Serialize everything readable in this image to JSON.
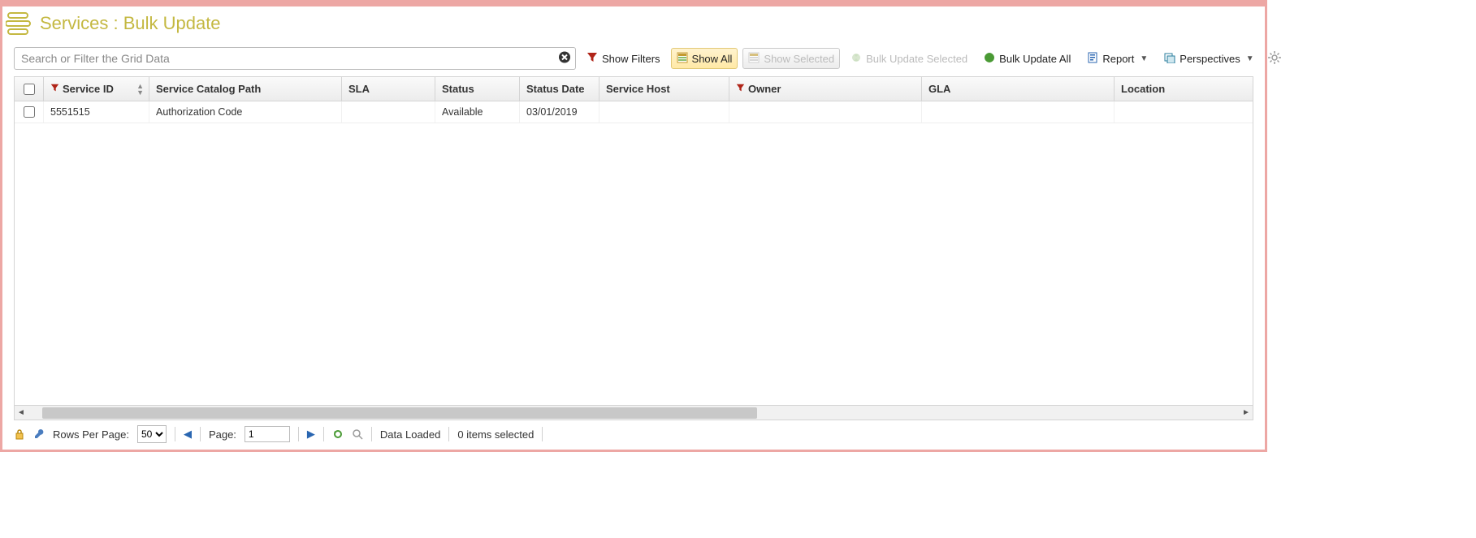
{
  "page": {
    "title": "Services : Bulk Update"
  },
  "search": {
    "placeholder": "Search or Filter the Grid Data"
  },
  "toolbar": {
    "show_filters": "Show Filters",
    "show_all": "Show All",
    "show_selected": "Show Selected",
    "bulk_update_selected": "Bulk Update Selected",
    "bulk_update_all": "Bulk Update All",
    "report": "Report",
    "perspectives": "Perspectives"
  },
  "columns": {
    "service_id": "Service ID",
    "service_catalog_path": "Service Catalog Path",
    "sla": "SLA",
    "status": "Status",
    "status_date": "Status Date",
    "service_host": "Service Host",
    "owner": "Owner",
    "gla": "GLA",
    "location": "Location"
  },
  "rows": [
    {
      "service_id": "5551515",
      "service_catalog_path": "Authorization Code",
      "sla": "",
      "status": "Available",
      "status_date": "03/01/2019",
      "service_host": "",
      "owner": "",
      "gla": "",
      "location": ""
    }
  ],
  "footer": {
    "rows_per_page_label": "Rows Per Page:",
    "rows_per_page_value": "50",
    "page_label": "Page:",
    "page_value": "1",
    "data_loaded": "Data Loaded",
    "items_selected": "0 items selected"
  }
}
